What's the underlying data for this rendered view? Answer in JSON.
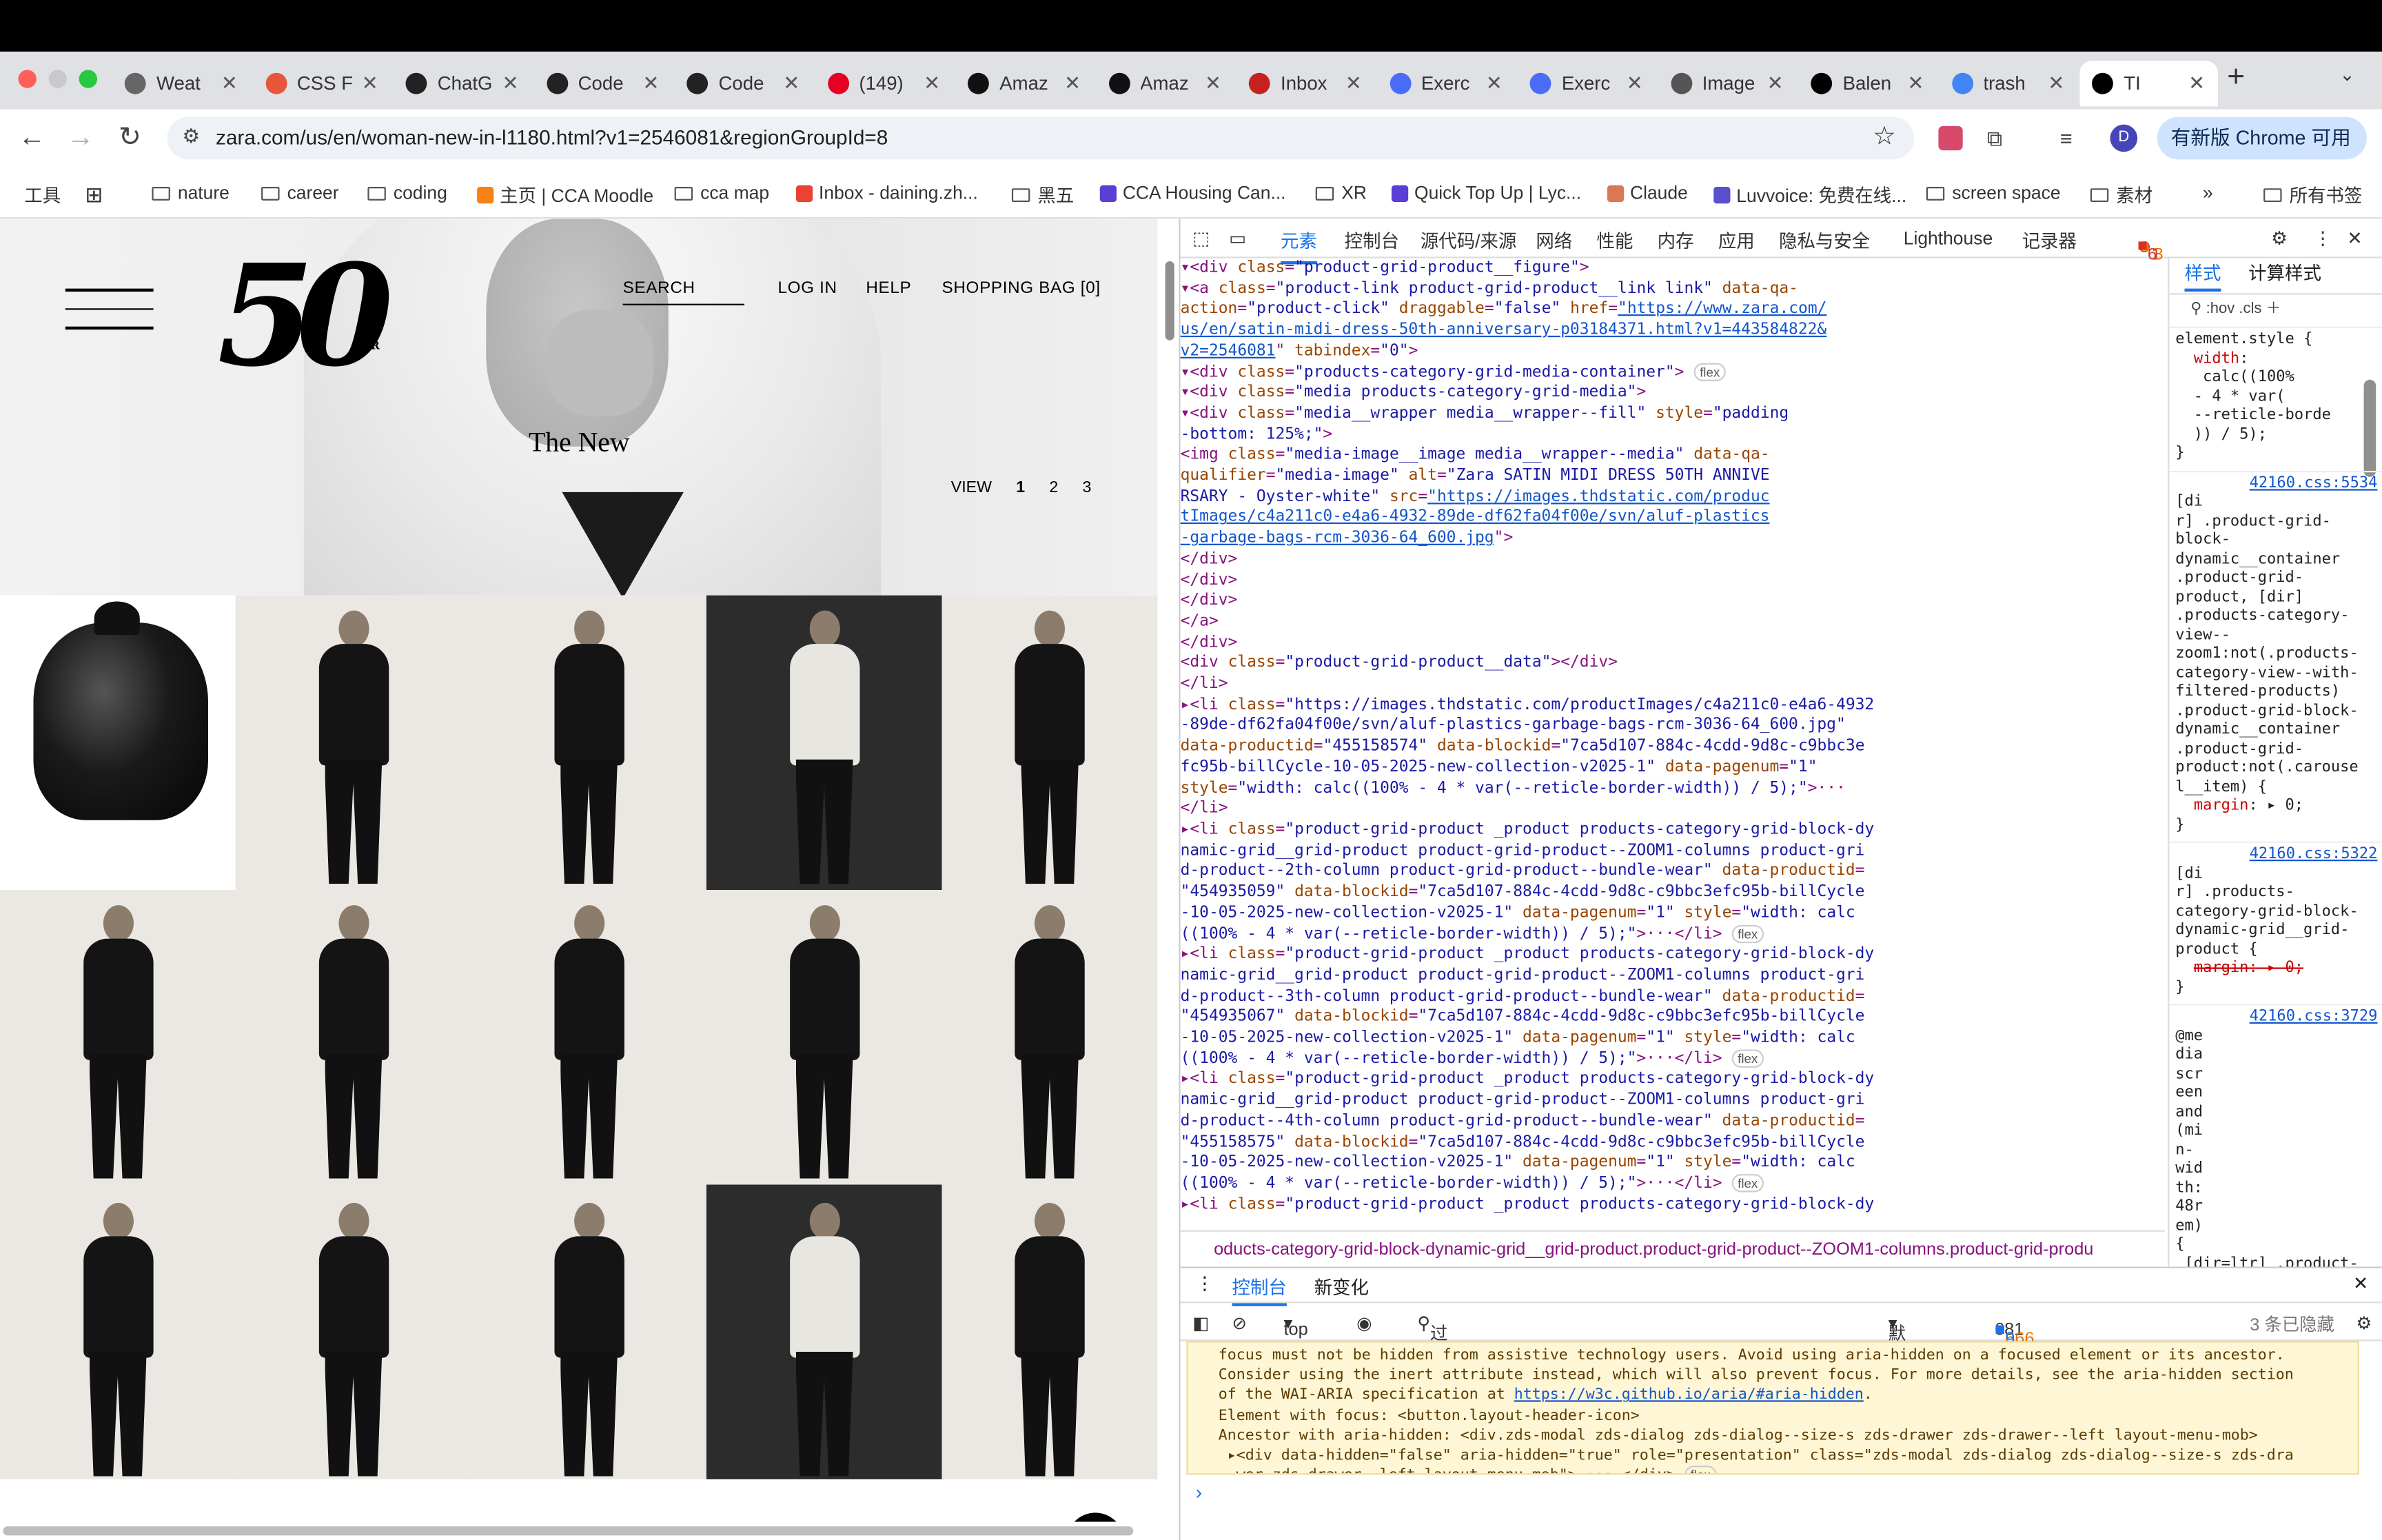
{
  "tabs": [
    {
      "label": "Weat",
      "fav": "#666"
    },
    {
      "label": "CSS F",
      "fav": "#e8553b"
    },
    {
      "label": "ChatG",
      "fav": "#222"
    },
    {
      "label": "Code",
      "fav": "#222"
    },
    {
      "label": "Code",
      "fav": "#222"
    },
    {
      "label": "(149)",
      "fav": "#e60023"
    },
    {
      "label": "Amaz",
      "fav": "#111"
    },
    {
      "label": "Amaz",
      "fav": "#111"
    },
    {
      "label": "Inbox",
      "fav": "#c5221f"
    },
    {
      "label": "Exerc",
      "fav": "#4a6cf7"
    },
    {
      "label": "Exerc",
      "fav": "#4a6cf7"
    },
    {
      "label": "Image",
      "fav": "#555"
    },
    {
      "label": "Balen",
      "fav": "#000"
    },
    {
      "label": "trash",
      "fav": "#4285f4"
    },
    {
      "label": "TI",
      "fav": "#000"
    }
  ],
  "omnibox": {
    "url": "zara.com/us/en/woman-new-in-l1180.html?v1=2546081&regionGroupId=8",
    "profile": "D",
    "update_button": "有新版 Chrome 可用"
  },
  "bookmarks": {
    "tools": "工具",
    "items": [
      {
        "label": "nature",
        "icon": "folder"
      },
      {
        "label": "career",
        "icon": "folder"
      },
      {
        "label": "coding",
        "icon": "folder"
      },
      {
        "label": "主页 | CCA Moodle",
        "icon": "moodle"
      },
      {
        "label": "cca map",
        "icon": "folder"
      },
      {
        "label": "Inbox - daining.zh...",
        "icon": "gmail"
      },
      {
        "label": "黑五",
        "icon": "folder"
      },
      {
        "label": "CCA Housing Can...",
        "icon": "app"
      },
      {
        "label": "XR",
        "icon": "folder"
      },
      {
        "label": "Quick Top Up | Lyc...",
        "icon": "app"
      },
      {
        "label": "Claude",
        "icon": "claude"
      },
      {
        "label": "Luvvoice: 免费在线...",
        "icon": "wave"
      },
      {
        "label": "screen space",
        "icon": "folder"
      },
      {
        "label": "素材",
        "icon": "folder"
      }
    ],
    "all": "所有书签"
  },
  "zara": {
    "logo": "50",
    "logo_sup": "ZR",
    "nav": {
      "search": "SEARCH",
      "login": "LOG IN",
      "help": "HELP",
      "bag": "SHOPPING BAG [0]"
    },
    "title": "The New",
    "view": {
      "label": "VIEW",
      "pages": [
        "1",
        "2",
        "3"
      ]
    }
  },
  "devtools": {
    "tabs": [
      "元素",
      "控制台",
      "源代码/来源",
      "网络",
      "性能",
      "内存",
      "应用",
      "隐私与安全",
      "Lighthouse",
      "记录器"
    ],
    "errors": "1",
    "warnings": "3",
    "issues": "6",
    "breadcrumb": "oducts-category-grid-block-dynamic-grid__grid-product.product-grid-product--ZOOM1-columns.product-grid-produ",
    "styles_tabs": [
      "样式",
      "计算样式"
    ],
    "styles_filter": ":hov .cls",
    "drawer_tabs": [
      "控制台",
      "新变化"
    ],
    "console": {
      "context": "top",
      "filter": "过滤",
      "level": "默认级别",
      "issues_text": "681 个问题:",
      "i_err": "6",
      "i_warn": "666",
      "i_info": "9",
      "hidden": "3 条已隐藏"
    }
  }
}
